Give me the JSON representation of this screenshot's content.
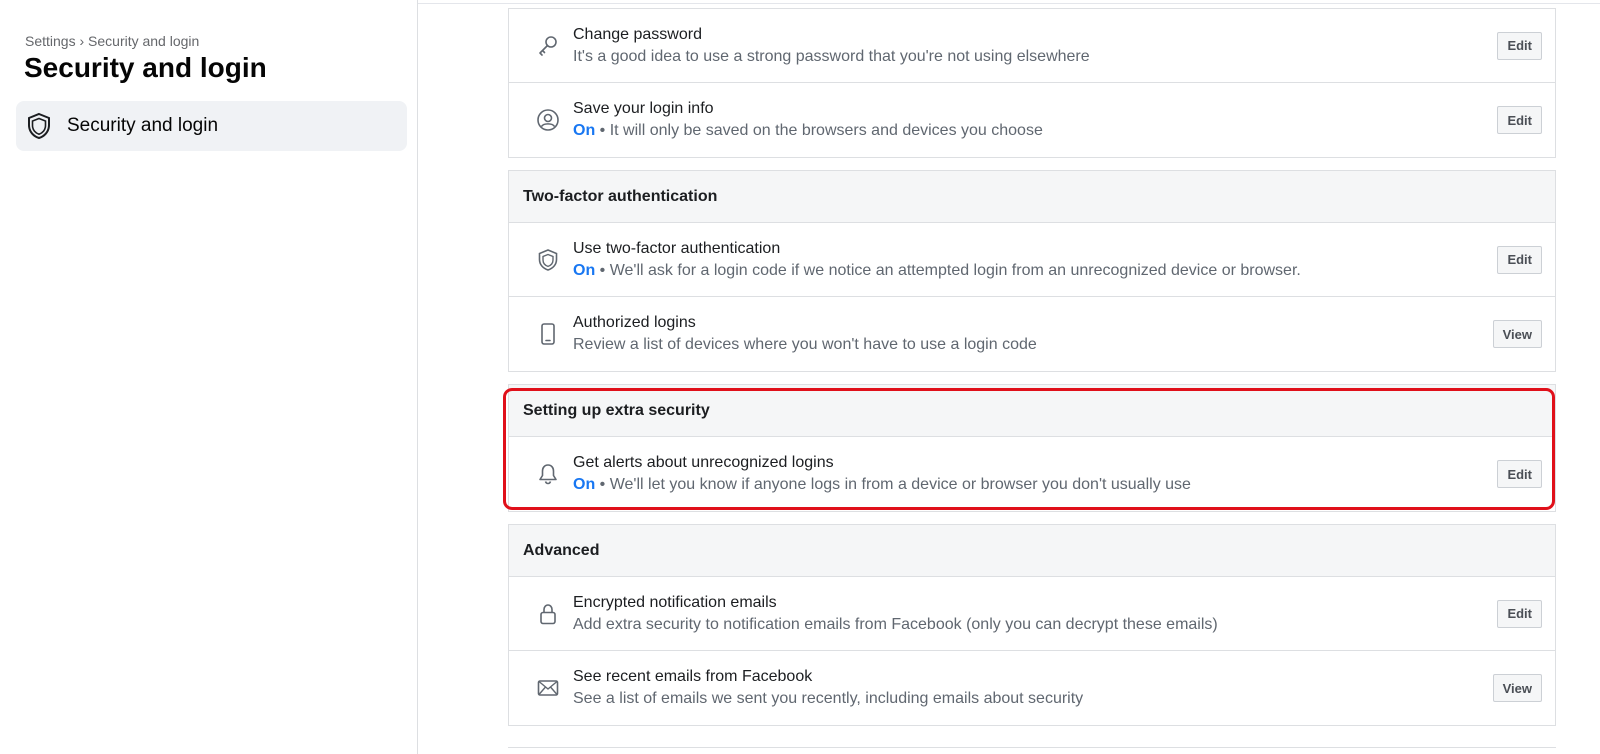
{
  "sidebar": {
    "breadcrumb": "Settings › Security and login",
    "title": "Security and login",
    "nav_item": {
      "label": "Security and login",
      "icon": "shield-icon"
    }
  },
  "sections": {
    "login": {
      "rows": [
        {
          "title": "Change password",
          "status": "",
          "desc": "It's a good idea to use a strong password that you're not using elsewhere",
          "button": "Edit",
          "icon": "key-icon"
        },
        {
          "title": "Save your login info",
          "status": "On",
          "desc": " • It will only be saved on the browsers and devices you choose",
          "button": "Edit",
          "icon": "user-circle-icon"
        }
      ]
    },
    "two_factor": {
      "header": "Two-factor authentication",
      "rows": [
        {
          "title": "Use two-factor authentication",
          "status": "On",
          "desc": " • We'll ask for a login code if we notice an attempted login from an unrecognized device or browser.",
          "button": "Edit",
          "icon": "shield-icon"
        },
        {
          "title": "Authorized logins",
          "status": "",
          "desc": "Review a list of devices where you won't have to use a login code",
          "button": "View",
          "icon": "phone-icon"
        }
      ]
    },
    "extra_security": {
      "header": "Setting up extra security",
      "rows": [
        {
          "title": "Get alerts about unrecognized logins",
          "status": "On",
          "desc": " • We'll let you know if anyone logs in from a device or browser you don't usually use",
          "button": "Edit",
          "icon": "bell-icon"
        }
      ]
    },
    "advanced": {
      "header": "Advanced",
      "rows": [
        {
          "title": "Encrypted notification emails",
          "status": "",
          "desc": "Add extra security to notification emails from Facebook (only you can decrypt these emails)",
          "button": "Edit",
          "icon": "lock-icon"
        },
        {
          "title": "See recent emails from Facebook",
          "status": "",
          "desc": "See a list of emails we sent you recently, including emails about security",
          "button": "View",
          "icon": "envelope-icon"
        }
      ]
    }
  },
  "colors": {
    "status_on": "#1877f2",
    "highlight": "#e0101a",
    "header_bg": "#f5f6f7"
  }
}
